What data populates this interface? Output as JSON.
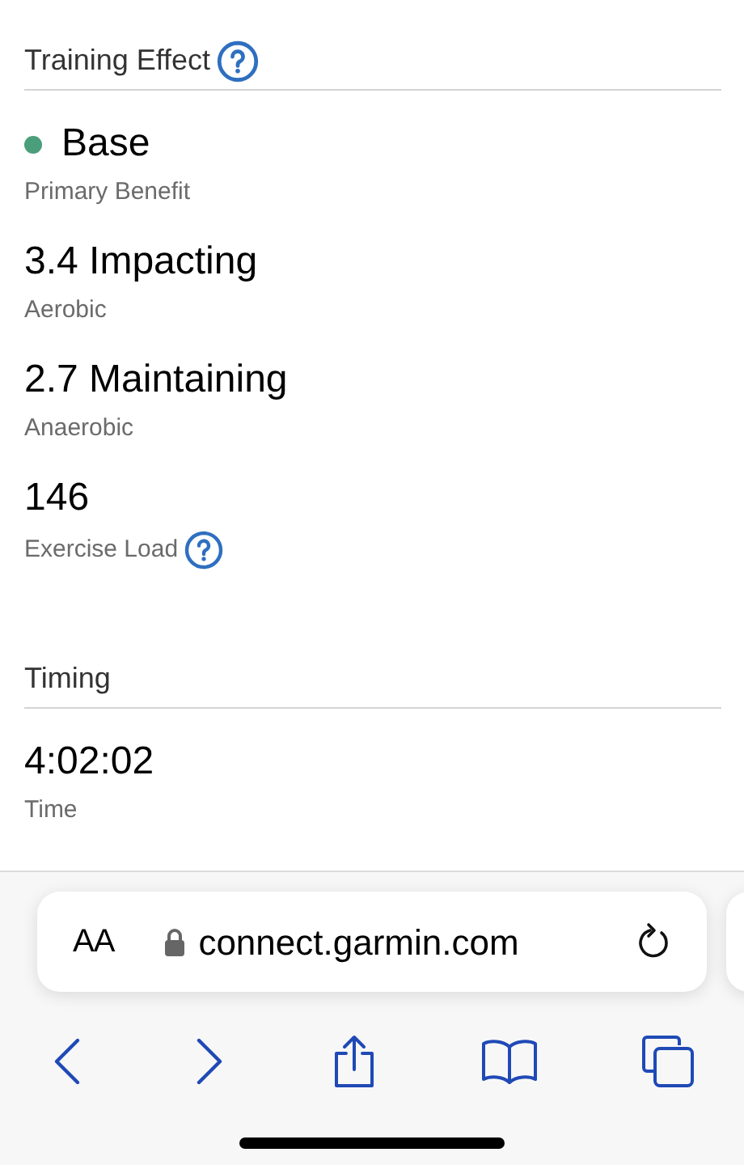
{
  "sections": [
    {
      "title": "Training Effect",
      "help": true,
      "metrics": [
        {
          "value": "Base",
          "label": "Primary Benefit",
          "color": "#4a9e7b",
          "help": false
        },
        {
          "value": "3.4 Impacting",
          "label": "Aerobic",
          "help": false
        },
        {
          "value": "2.7 Maintaining",
          "label": "Anaerobic",
          "help": false
        },
        {
          "value": "146",
          "label": "Exercise Load",
          "help": true
        }
      ]
    },
    {
      "title": "Timing",
      "help": false,
      "metrics": [
        {
          "value": "4:02:02",
          "label": "Time",
          "help": false
        }
      ]
    }
  ],
  "browser": {
    "text_size": "AA",
    "url": "connect.garmin.com"
  }
}
